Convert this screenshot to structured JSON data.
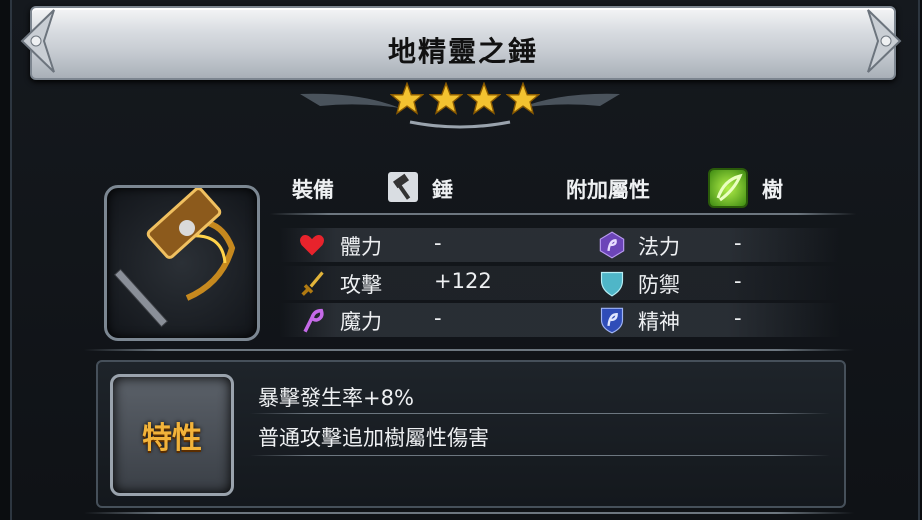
{
  "item": {
    "name": "地精靈之錘",
    "stars": 4
  },
  "info": {
    "equip_label": "裝備",
    "equip_type": "錘",
    "attribute_label": "附加屬性",
    "attribute_value": "樹"
  },
  "stats": {
    "left": [
      {
        "label": "體力",
        "value": "-",
        "icon": "heart-icon",
        "color": "#e8232c"
      },
      {
        "label": "攻擊",
        "value": "+122",
        "icon": "sword-icon",
        "color": "#e2b43a"
      },
      {
        "label": "魔力",
        "value": "-",
        "icon": "magic-staff-icon",
        "color": "#c56ae8"
      }
    ],
    "right": [
      {
        "label": "法力",
        "value": "-",
        "icon": "mana-hex-icon",
        "color": "#8a5fd0"
      },
      {
        "label": "防禦",
        "value": "-",
        "icon": "shield-icon",
        "color": "#5fc7d6"
      },
      {
        "label": "精神",
        "value": "-",
        "icon": "spirit-shield-icon",
        "color": "#3a5bc8"
      }
    ]
  },
  "trait": {
    "badge_label": "特性",
    "lines": [
      "暴擊發生率+8%",
      "普通攻擊追加樹屬性傷害"
    ]
  }
}
